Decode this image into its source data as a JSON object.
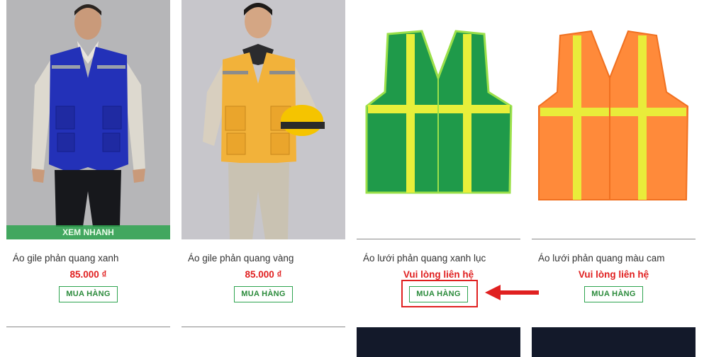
{
  "products": [
    {
      "title": "Áo gile phản quang xanh",
      "price": "85.000 ₫",
      "buy_label": "MUA HÀNG",
      "quick_view": "XEM NHANH"
    },
    {
      "title": "Áo gile phản quang vàng",
      "price": "85.000 ₫",
      "buy_label": "MUA HÀNG"
    },
    {
      "title": "Áo lưới phản quang xanh lục",
      "price": "Vui lòng liên hệ",
      "buy_label": "MUA HÀNG"
    },
    {
      "title": "Áo lưới phản quang màu cam",
      "price": "Vui lòng liên hệ",
      "buy_label": "MUA HÀNG"
    }
  ],
  "annotation": {
    "highlight_color": "#e02020",
    "arrow_icon": "arrow-left-icon"
  },
  "colors": {
    "accent_green": "#2ea44f",
    "price_red": "#e02020"
  }
}
